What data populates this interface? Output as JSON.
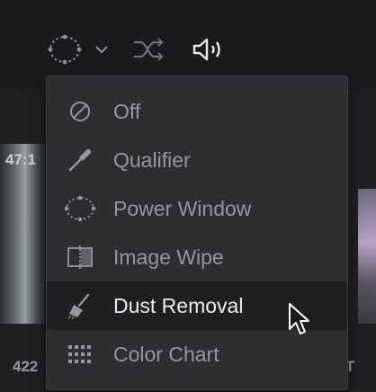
{
  "toolbar": {
    "icons": [
      "power-window-icon",
      "chevron-down-icon",
      "shuffle-icon",
      "speaker-icon"
    ]
  },
  "viewer": {
    "timecode_top": "47:1",
    "timecode_bottom": "422",
    "right_label": "T"
  },
  "menu": {
    "items": [
      {
        "label": "Off",
        "icon": "off-icon"
      },
      {
        "label": "Qualifier",
        "icon": "qualifier-eyedropper-icon"
      },
      {
        "label": "Power Window",
        "icon": "power-window-icon"
      },
      {
        "label": "Image Wipe",
        "icon": "image-wipe-icon"
      },
      {
        "label": "Dust Removal",
        "icon": "dust-removal-brush-icon",
        "hovered": true
      },
      {
        "label": "Color Chart",
        "icon": "color-chart-icon"
      }
    ]
  },
  "colors": {
    "menu_bg": "#2e2e31",
    "hover_bg": "#1f1f22",
    "text_dim": "#96969c",
    "text_bright": "#ececef"
  }
}
